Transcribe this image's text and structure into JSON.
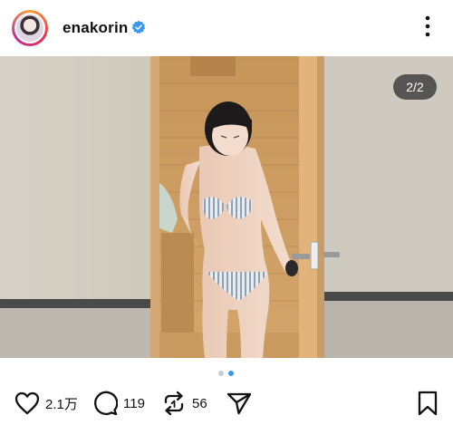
{
  "post": {
    "username": "enakorin",
    "verified_icon": "verified-badge-icon",
    "more_icon": "more-vertical-icon",
    "accent_color": "#3897f0",
    "carousel": {
      "counter": "2/2",
      "active_index": 2,
      "total": 2
    },
    "actions": {
      "likes": "2.1万",
      "comments": "119",
      "reposts": "56",
      "like_icon": "heart-icon",
      "comment_icon": "comment-icon",
      "repost_icon": "repost-icon",
      "share_icon": "share-icon",
      "save_icon": "bookmark-icon"
    }
  }
}
